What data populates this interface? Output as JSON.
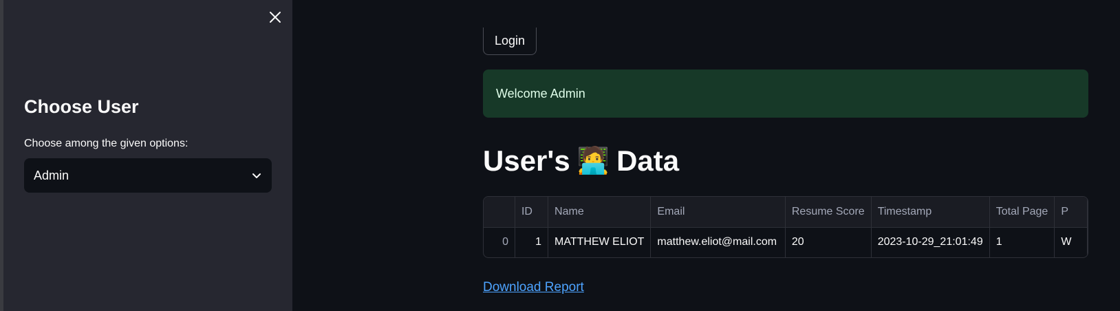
{
  "sidebar": {
    "title": "Choose User",
    "select_label": "Choose among the given options:",
    "select_value": "Admin"
  },
  "main": {
    "login_label": "Login",
    "success_message": "Welcome Admin",
    "heading_before": "User's",
    "heading_emoji": "🧑‍💻",
    "heading_after": "Data",
    "download_label": "Download Report"
  },
  "table": {
    "columns": [
      "",
      "ID",
      "Name",
      "Email",
      "Resume Score",
      "Timestamp",
      "Total Page",
      "P"
    ],
    "rows": [
      [
        "0",
        "1",
        "MATTHEW ELIOT",
        "matthew.eliot@mail.com",
        "20",
        "2023-10-29_21:01:49",
        "1",
        "W"
      ]
    ]
  },
  "colors": {
    "background": "#0e1117",
    "sidebar": "#262730",
    "success_bg": "#173928",
    "link": "#4da3ff"
  }
}
